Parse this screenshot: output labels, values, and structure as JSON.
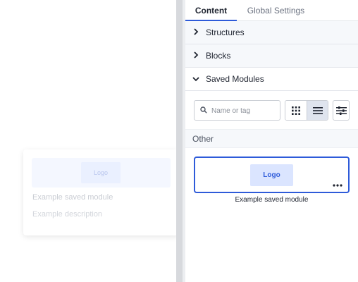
{
  "canvas": {
    "ghost_card": {
      "logo_text": "Logo",
      "title": "Example saved module",
      "description": "Example description"
    }
  },
  "panel": {
    "tabs": [
      {
        "label": "Content",
        "active": true
      },
      {
        "label": "Global Settings",
        "active": false
      }
    ],
    "sections": [
      {
        "label": "Structures",
        "expanded": false
      },
      {
        "label": "Blocks",
        "expanded": false
      },
      {
        "label": "Saved Modules",
        "expanded": true
      }
    ],
    "search": {
      "placeholder": "Name or tag",
      "value": ""
    },
    "view_toggle": {
      "options": [
        "grid-view-icon",
        "list-view-icon"
      ],
      "selected": "list-view-icon"
    },
    "filter_icon": "filter-sliders-icon",
    "group_label": "Other",
    "module": {
      "logo_text": "Logo",
      "more_label": "...",
      "name": "Example saved module"
    }
  },
  "colors": {
    "accent": "#2e5bd9",
    "list_toggle_selected": "#dfe4ee",
    "section_bg": "#f6f8fb"
  }
}
